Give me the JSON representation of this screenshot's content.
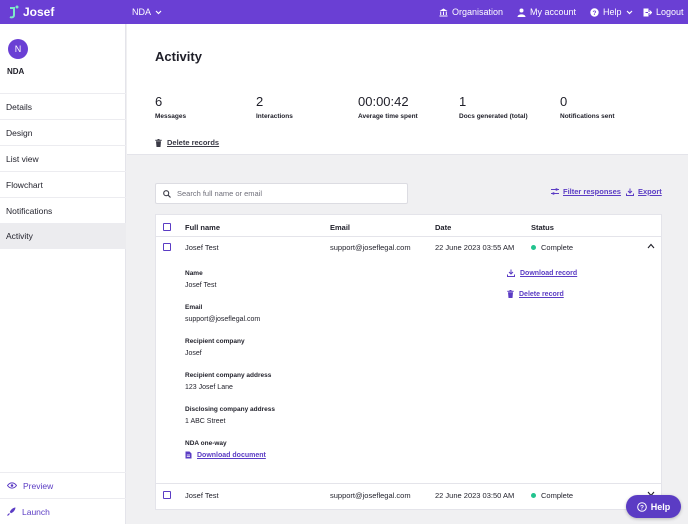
{
  "topbar": {
    "logo_text": "Josef",
    "project": "NDA",
    "organisation": "Organisation",
    "my_account": "My account",
    "help": "Help",
    "logout": "Logout"
  },
  "sidebar": {
    "avatar_initial": "N",
    "project_name": "NDA",
    "items": [
      {
        "label": "Details"
      },
      {
        "label": "Design"
      },
      {
        "label": "List view"
      },
      {
        "label": "Flowchart"
      },
      {
        "label": "Notifications"
      },
      {
        "label": "Activity",
        "active": true
      }
    ],
    "preview": "Preview",
    "launch": "Launch"
  },
  "activity": {
    "title": "Activity",
    "stats": [
      {
        "value": "6",
        "label": "Messages"
      },
      {
        "value": "2",
        "label": "Interactions"
      },
      {
        "value": "00:00:42",
        "label": "Average time spent"
      },
      {
        "value": "1",
        "label": "Docs generated (total)"
      },
      {
        "value": "0",
        "label": "Notifications sent"
      }
    ],
    "delete_records": "Delete records"
  },
  "search": {
    "placeholder": "Search full name or email"
  },
  "filter_responses": "Filter responses",
  "export": "Export",
  "table": {
    "columns": [
      "Full name",
      "Email",
      "Date",
      "Status"
    ],
    "rows": [
      {
        "name": "Josef Test",
        "email": "support@joseflegal.com",
        "date": "22 June 2023 03:55 AM",
        "status": "Complete"
      },
      {
        "name": "Josef Test",
        "email": "support@joseflegal.com",
        "date": "22 June 2023 03:50 AM",
        "status": "Complete"
      }
    ],
    "detail": {
      "fields": [
        {
          "label": "Name",
          "value": "Josef Test"
        },
        {
          "label": "Email",
          "value": "support@joseflegal.com"
        },
        {
          "label": "Recipient company",
          "value": "Josef"
        },
        {
          "label": "Recipient company address",
          "value": "123 Josef Lane"
        },
        {
          "label": "Disclosing company address",
          "value": "1 ABC Street"
        }
      ],
      "nda_label": "NDA one-way",
      "download_document": "Download document",
      "download_record": "Download record",
      "delete_record": "Delete record"
    }
  },
  "help_button": "Help",
  "colors": {
    "brand": "#6a3fd4",
    "accent": "#5b3cc4",
    "status_complete": "#22c38e"
  }
}
